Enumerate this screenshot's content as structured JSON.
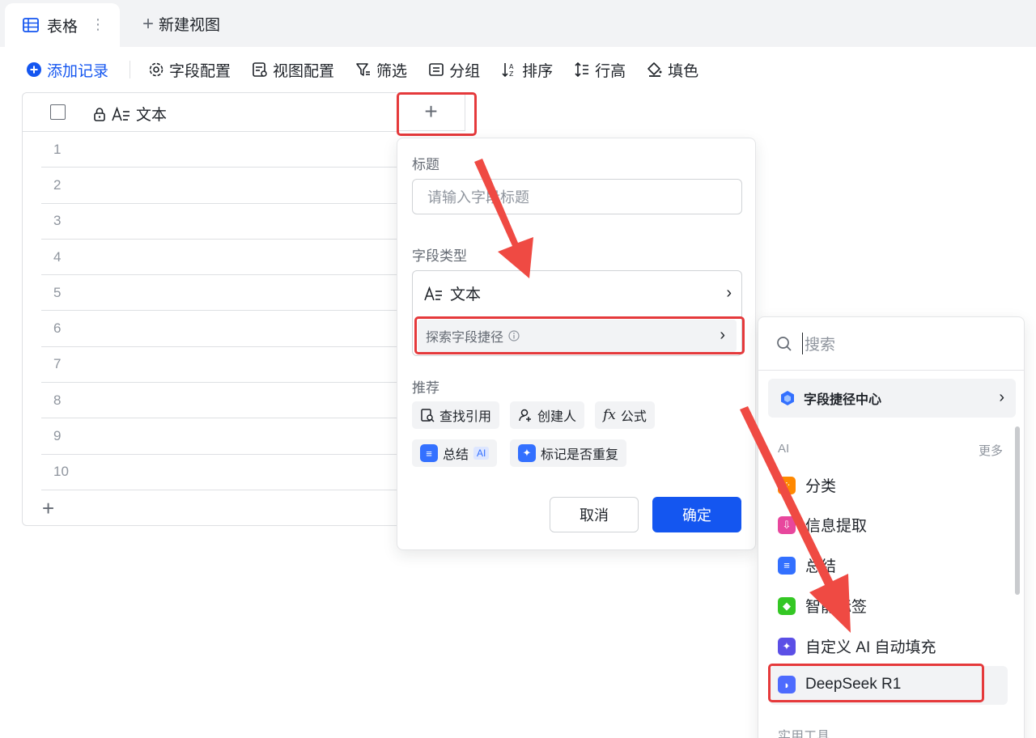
{
  "tabs": {
    "active_label": "表格",
    "new_view_label": "新建视图"
  },
  "toolbar": {
    "add_record": "添加记录",
    "field_config": "字段配置",
    "view_config": "视图配置",
    "filter": "筛选",
    "group": "分组",
    "sort": "排序",
    "row_height": "行高",
    "fill_color": "填色"
  },
  "grid": {
    "column_header": "文本",
    "rows": [
      "1",
      "2",
      "3",
      "4",
      "5",
      "6",
      "7",
      "8",
      "9",
      "10"
    ]
  },
  "field_panel": {
    "title_label": "标题",
    "title_placeholder": "请输入字段标题",
    "type_label": "字段类型",
    "type_value": "文本",
    "explore_shortcuts": "探索字段捷径",
    "recommend_label": "推荐",
    "chips": [
      "查找引用",
      "创建人",
      "公式",
      "总结",
      "标记是否重复"
    ],
    "ai_badge": "AI",
    "cancel": "取消",
    "confirm": "确定"
  },
  "shortcut_menu": {
    "search_placeholder": "搜索",
    "center": "字段捷径中心",
    "ai_section": "AI",
    "more": "更多",
    "items": [
      {
        "label": "分类",
        "color": "#ff8800"
      },
      {
        "label": "信息提取",
        "color": "#e8479d"
      },
      {
        "label": "总结",
        "color": "#3370ff"
      },
      {
        "label": "智能标签",
        "color": "#34c724"
      },
      {
        "label": "自定义 AI 自动填充",
        "color": "#5b4fe6"
      },
      {
        "label": "DeepSeek R1",
        "color": "#4d6bfe"
      }
    ],
    "tools_section": "实用工具"
  },
  "colors": {
    "accent": "#1456f0",
    "highlight": "#e5393b"
  }
}
